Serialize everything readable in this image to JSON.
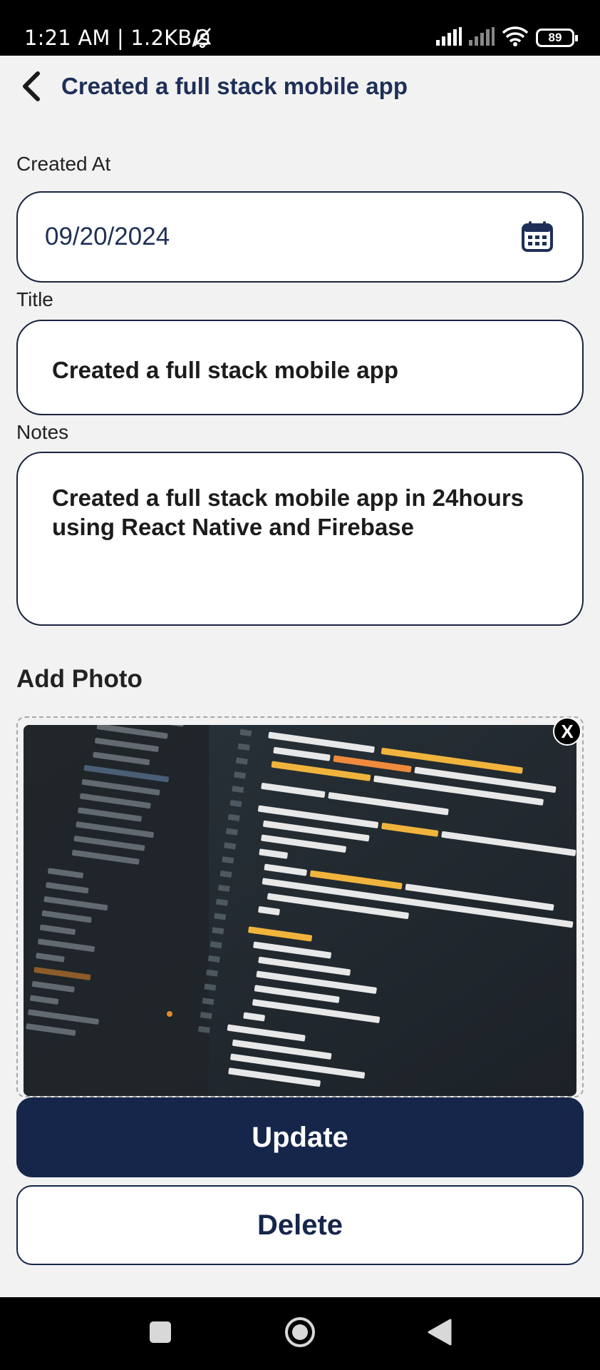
{
  "status_bar": {
    "time_text": "1:21 AM | 1.2KB/s",
    "battery": "89",
    "icons": [
      "bell-muted-icon",
      "signal-icon",
      "signal-icon",
      "wifi-icon",
      "battery-icon"
    ]
  },
  "header": {
    "back_icon": "chevron-left-icon",
    "title": "Created a full stack mobile app"
  },
  "form": {
    "created_at_label": "Created At",
    "created_at_value": "09/20/2024",
    "calendar_icon": "calendar-icon",
    "title_label": "Title",
    "title_value": "Created a full stack mobile app",
    "notes_label": "Notes",
    "notes_value": "Created a full stack mobile app in 24hours using React Native and Firebase",
    "add_photo_label": "Add Photo",
    "remove_photo_label": "X"
  },
  "actions": {
    "update_label": "Update",
    "delete_label": "Delete"
  },
  "nav": {
    "icons": [
      "recents-square-icon",
      "home-circle-icon",
      "back-triangle-icon"
    ]
  },
  "colors": {
    "primary": "#15264a",
    "title_text": "#1e2f57",
    "background": "#f2f2f2"
  }
}
